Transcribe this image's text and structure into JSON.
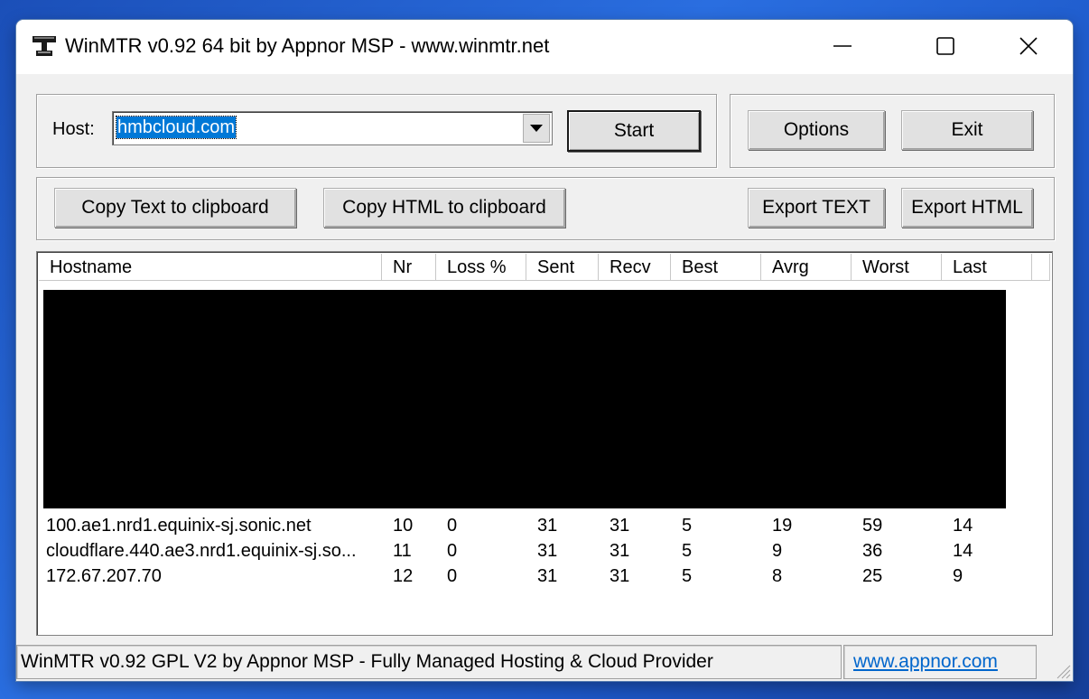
{
  "window": {
    "title": "WinMTR v0.92 64 bit by Appnor MSP - www.winmtr.net",
    "icons": [
      "app-icon",
      "minimize-icon",
      "maximize-icon",
      "close-icon"
    ]
  },
  "host": {
    "label": "Host:",
    "value": "hmbcloud.com"
  },
  "buttons": {
    "start": "Start",
    "options": "Options",
    "exit": "Exit",
    "copy_text": "Copy Text to clipboard",
    "copy_html": "Copy HTML to clipboard",
    "export_text": "Export TEXT",
    "export_html": "Export HTML"
  },
  "table": {
    "columns": [
      "Hostname",
      "Nr",
      "Loss %",
      "Sent",
      "Recv",
      "Best",
      "Avrg",
      "Worst",
      "Last"
    ],
    "rows": [
      {
        "host": "100.ae1.nrd1.equinix-sj.sonic.net",
        "nr": "10",
        "loss": "0",
        "sent": "31",
        "recv": "31",
        "best": "5",
        "avrg": "19",
        "worst": "59",
        "last": "14"
      },
      {
        "host": "cloudflare.440.ae3.nrd1.equinix-sj.so...",
        "nr": "11",
        "loss": "0",
        "sent": "31",
        "recv": "31",
        "best": "5",
        "avrg": "9",
        "worst": "36",
        "last": "14"
      },
      {
        "host": "172.67.207.70",
        "nr": "12",
        "loss": "0",
        "sent": "31",
        "recv": "31",
        "best": "5",
        "avrg": "8",
        "worst": "25",
        "last": "9"
      }
    ]
  },
  "status": {
    "text": "WinMTR v0.92 GPL V2 by Appnor MSP - Fully Managed Hosting & Cloud Provider",
    "link": "www.appnor.com"
  }
}
